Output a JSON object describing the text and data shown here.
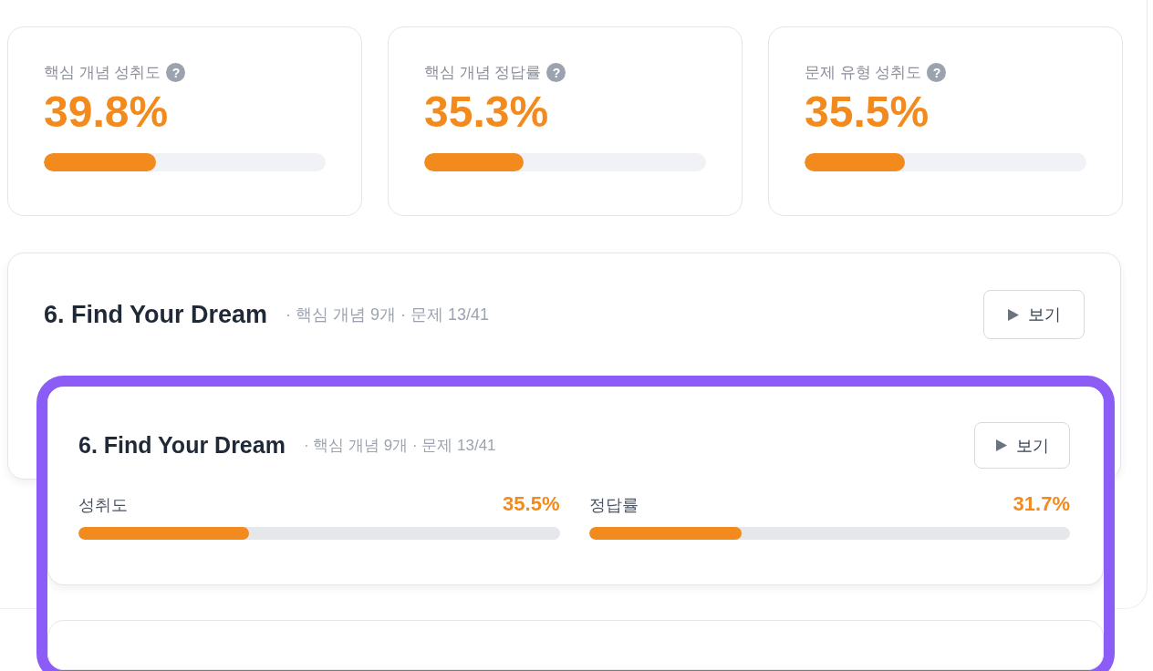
{
  "stat_cards": [
    {
      "label": "핵심 개념 성취도",
      "hint": "?",
      "value": "39.8%",
      "level": 0.398
    },
    {
      "label": "핵심 개념 정답률",
      "hint": "?",
      "value": "35.3%",
      "level": 0.353
    },
    {
      "label": "문제 유형 성취도",
      "hint": "?",
      "value": "35.5%",
      "level": 0.355
    }
  ],
  "chapter_card": {
    "title": "6. Find Your Dream",
    "meta": "· 핵심 개념 9개 · 문제 13/41",
    "button": "보기"
  },
  "magnifier": {
    "chapter_card": {
      "title": "6. Find Your Dream",
      "meta": "· 핵심 개념 9개 · 문제 13/41",
      "button": "보기",
      "metrics": [
        {
          "label": "성취도",
          "value": "35.5%",
          "level": 0.355
        },
        {
          "label": "정답률",
          "value": "31.7%",
          "level": 0.317
        }
      ]
    }
  }
}
